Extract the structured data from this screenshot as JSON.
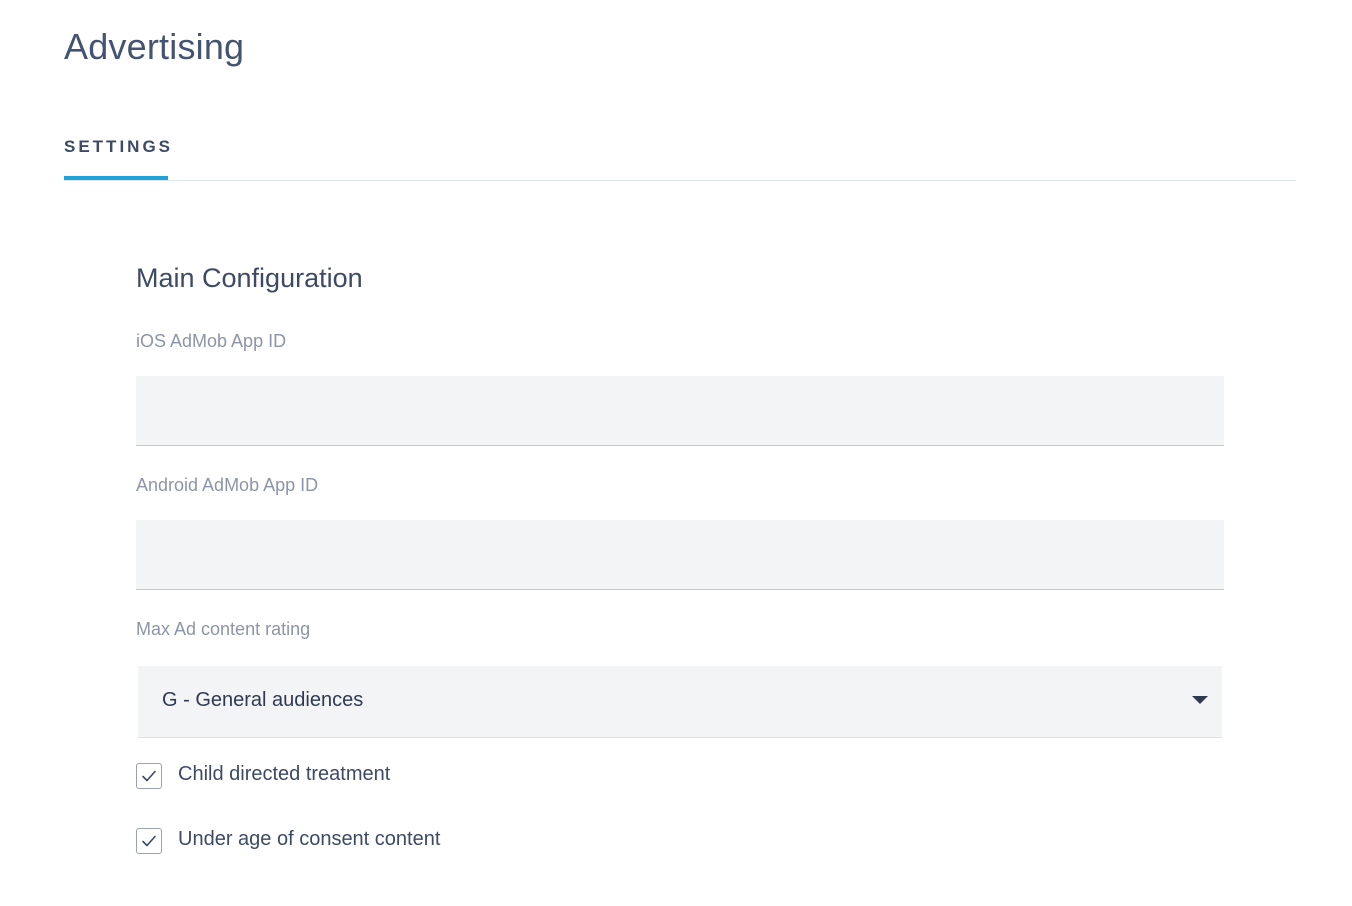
{
  "page": {
    "title": "Advertising"
  },
  "tabs": [
    {
      "label": "SETTINGS",
      "active": true
    }
  ],
  "section": {
    "title": "Main Configuration"
  },
  "fields": {
    "ios_admob": {
      "label": "iOS AdMob App ID",
      "value": "",
      "placeholder": ""
    },
    "android_admob": {
      "label": "Android AdMob App ID",
      "value": "",
      "placeholder": ""
    },
    "max_ad_rating": {
      "label": "Max Ad content rating",
      "selected": "G - General audiences"
    }
  },
  "checkboxes": {
    "child_directed": {
      "label": "Child directed treatment",
      "checked": true
    },
    "under_age_consent": {
      "label": "Under age of consent content",
      "checked": true
    }
  },
  "colors": {
    "accent": "#1ea2d8",
    "text": "#3d4a66",
    "muted_label": "#8c95a8",
    "input_bg": "#f3f4f6"
  },
  "icons": {
    "dropdown": "caret-down-icon",
    "check": "checkmark-icon"
  }
}
